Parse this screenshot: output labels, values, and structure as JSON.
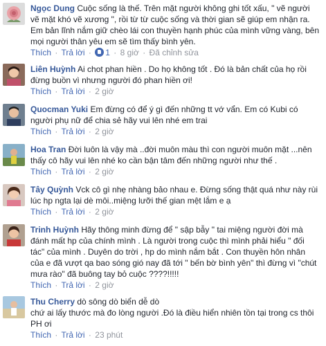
{
  "actions": {
    "like": "Thích",
    "reply": "Trả lời",
    "separator": "·"
  },
  "comments": [
    {
      "name": "Ngọc Dung",
      "lines": [
        "Cuộc sống là thế. Trên mặt người không ghi tốt xấu, \" vẽ người",
        "vẽ mặt khó vẽ xương \", rồi từ từ cuộc sống và thời gian sẽ giúp em nhận ra.",
        "Em bản lĩnh nắm giữ chèo lái con thuyền hạnh phúc của mình vững vàng, bên",
        "mọi người thân yêu em sẽ tìm thấy bình yên."
      ],
      "like_count": "1",
      "time": "8 giờ",
      "edited": "Đã chỉnh sửa",
      "avatar_icon": "rose-flower-avatar-icon"
    },
    {
      "name": "Liên Huỳnh",
      "lines": [
        "Ai chot phan hiền . Do họ không tốt . Đó là bản chất của họ rồi",
        "đừng buồn vì nhưng người đó phan hiền ơi!"
      ],
      "time": "2 giờ",
      "avatar_icon": "woman-portrait-avatar-icon"
    },
    {
      "name": "Quocman Yuki",
      "lines": [
        "Em đừng có để ý gì đến những tt vớ vẩn. Em có Kubi có",
        "người phụ nữ để chia sẻ hãy vui lên nhé em trai"
      ],
      "time": "2 giờ",
      "avatar_icon": "man-portrait-avatar-icon"
    },
    {
      "name": "Hoa Tran",
      "lines": [
        "Đời luôn là vậy mà ..đời muôn màu thì con người muôn mặt ...nên",
        "thấy cô hãy vui lên nhé ko cần bận tâm đến những người như thế ."
      ],
      "time": "2 giờ",
      "avatar_icon": "outdoor-person-avatar-icon"
    },
    {
      "name": "Tây Quỳnh",
      "lines": [
        "Vck cô gì nhẹ nhàng bảo nhau e. Đừng sống thật quá như này rùi",
        "lúc hp ngta lại dè môi..miệng lưỡi thế gian mệt lắm e ạ"
      ],
      "time": "2 giờ",
      "avatar_icon": "woman-smiling-avatar-icon"
    },
    {
      "name": "Trinh Huỳnh",
      "lines": [
        "Hãy thông minh đừng để \" sập bẫy \" tai miệng người đời mà",
        "đánh mất hp của chính mình . Là người trong cuộc thì mình phải hiểu \" đối",
        "tác\" của mình . Duyên do trời , hp do mình nắm bắt . Con thuyền hôn nhân",
        "của e đã vượt qa bao sóng gió nay đã tới \" bến bờ bình yên\" thì đừng vì \"chút",
        "mưa rào\" đã buông tay bỏ cuộc ????!!!!!"
      ],
      "time": "2 giờ",
      "avatar_icon": "woman-red-shirt-avatar-icon"
    },
    {
      "name": "Thu Cherry",
      "lines": [
        "dò sông dò biển dễ dò",
        "chứ ai lấy thước mà đo lòng người .Đó là điều hiển nhiên tồn tại trong cs thôi",
        "PH ơi"
      ],
      "time": "23 phút",
      "avatar_icon": "beach-person-avatar-icon"
    }
  ]
}
